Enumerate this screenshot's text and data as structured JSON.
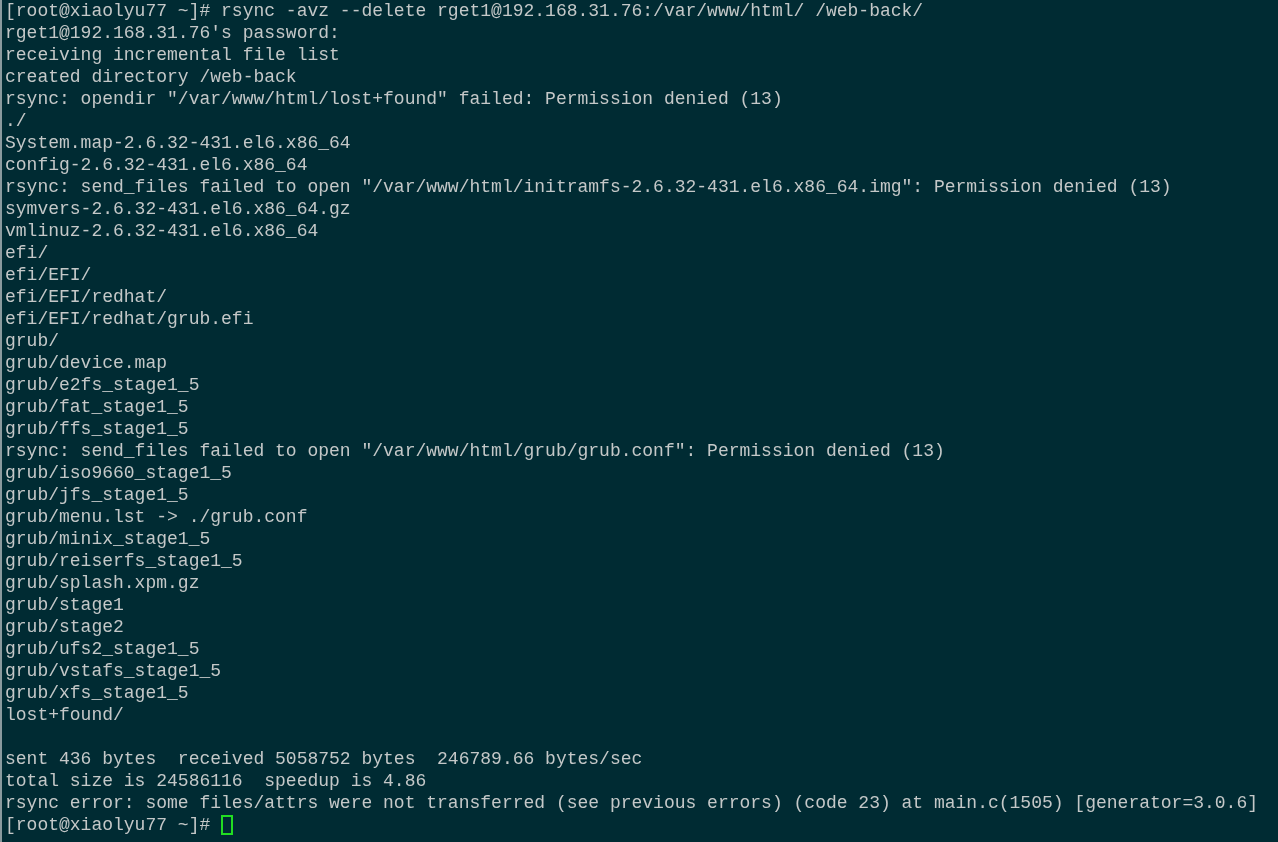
{
  "terminal": {
    "lines": [
      {
        "kind": "output",
        "text": "[root@xiaolyu77 ~]# rsync -avz --delete rget1@192.168.31.76:/var/www/html/ /web-back/"
      },
      {
        "kind": "output",
        "text": "rget1@192.168.31.76's password:"
      },
      {
        "kind": "output",
        "text": "receiving incremental file list"
      },
      {
        "kind": "output",
        "text": "created directory /web-back"
      },
      {
        "kind": "output",
        "text": "rsync: opendir \"/var/www/html/lost+found\" failed: Permission denied (13)"
      },
      {
        "kind": "output",
        "text": "./"
      },
      {
        "kind": "output",
        "text": "System.map-2.6.32-431.el6.x86_64"
      },
      {
        "kind": "output",
        "text": "config-2.6.32-431.el6.x86_64"
      },
      {
        "kind": "output",
        "text": "rsync: send_files failed to open \"/var/www/html/initramfs-2.6.32-431.el6.x86_64.img\": Permission denied (13)"
      },
      {
        "kind": "output",
        "text": "symvers-2.6.32-431.el6.x86_64.gz"
      },
      {
        "kind": "output",
        "text": "vmlinuz-2.6.32-431.el6.x86_64"
      },
      {
        "kind": "output",
        "text": "efi/"
      },
      {
        "kind": "output",
        "text": "efi/EFI/"
      },
      {
        "kind": "output",
        "text": "efi/EFI/redhat/"
      },
      {
        "kind": "output",
        "text": "efi/EFI/redhat/grub.efi"
      },
      {
        "kind": "output",
        "text": "grub/"
      },
      {
        "kind": "output",
        "text": "grub/device.map"
      },
      {
        "kind": "output",
        "text": "grub/e2fs_stage1_5"
      },
      {
        "kind": "output",
        "text": "grub/fat_stage1_5"
      },
      {
        "kind": "output",
        "text": "grub/ffs_stage1_5"
      },
      {
        "kind": "output",
        "text": "rsync: send_files failed to open \"/var/www/html/grub/grub.conf\": Permission denied (13)"
      },
      {
        "kind": "output",
        "text": "grub/iso9660_stage1_5"
      },
      {
        "kind": "output",
        "text": "grub/jfs_stage1_5"
      },
      {
        "kind": "output",
        "text": "grub/menu.lst -> ./grub.conf"
      },
      {
        "kind": "output",
        "text": "grub/minix_stage1_5"
      },
      {
        "kind": "output",
        "text": "grub/reiserfs_stage1_5"
      },
      {
        "kind": "output",
        "text": "grub/splash.xpm.gz"
      },
      {
        "kind": "output",
        "text": "grub/stage1"
      },
      {
        "kind": "output",
        "text": "grub/stage2"
      },
      {
        "kind": "output",
        "text": "grub/ufs2_stage1_5"
      },
      {
        "kind": "output",
        "text": "grub/vstafs_stage1_5"
      },
      {
        "kind": "output",
        "text": "grub/xfs_stage1_5"
      },
      {
        "kind": "output",
        "text": "lost+found/"
      },
      {
        "kind": "blank"
      },
      {
        "kind": "output",
        "text": "sent 436 bytes  received 5058752 bytes  246789.66 bytes/sec"
      },
      {
        "kind": "output",
        "text": "total size is 24586116  speedup is 4.86"
      },
      {
        "kind": "output",
        "text": "rsync error: some files/attrs were not transferred (see previous errors) (code 23) at main.c(1505) [generator=3.0.6]"
      },
      {
        "kind": "prompt",
        "text": "[root@xiaolyu77 ~]#",
        "cursor": true
      }
    ]
  }
}
